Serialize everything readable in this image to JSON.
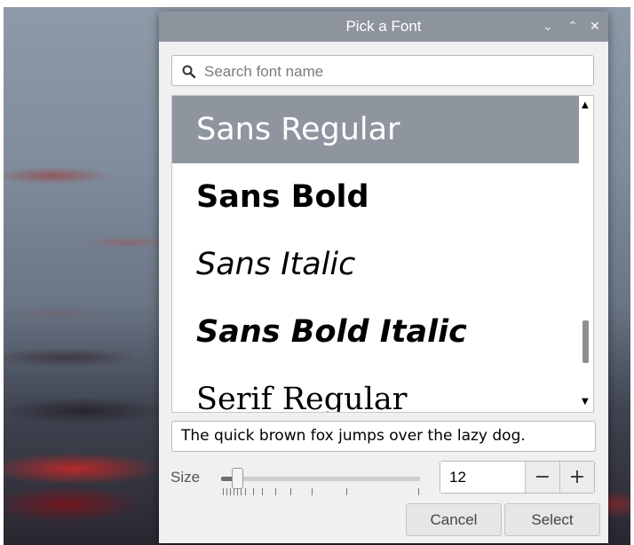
{
  "dialog": {
    "title": "Pick a Font",
    "controls": {
      "minimize": "⌄",
      "maximize": "⌃",
      "close": "✕"
    }
  },
  "search": {
    "placeholder": "Search font name",
    "value": ""
  },
  "fonts": [
    {
      "label": "Sans Regular",
      "selected": true
    },
    {
      "label": "Sans Bold",
      "selected": false
    },
    {
      "label": "Sans Italic",
      "selected": false
    },
    {
      "label": "Sans Bold Italic",
      "selected": false
    },
    {
      "label": "Serif Regular",
      "selected": false
    }
  ],
  "preview": {
    "text": "The quick brown fox jumps over the lazy dog."
  },
  "size": {
    "label": "Size",
    "value": "12",
    "decrement": "−",
    "increment": "+"
  },
  "buttons": {
    "cancel": "Cancel",
    "select": "Select"
  }
}
